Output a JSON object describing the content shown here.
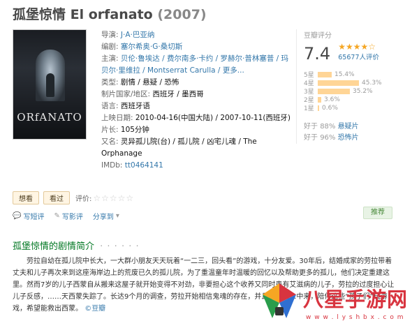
{
  "title": "孤堡惊情 El orfanato",
  "year": "(2007)",
  "poster_title": "ORfANATO",
  "info": {
    "director_label": "导演:",
    "director": "J·A·巴亚纳",
    "writer_label": "编剧:",
    "writer": "塞尔希奥·G·桑切斯",
    "cast_label": "主演:",
    "cast": "贝伦·鲁埃达 / 费尔南多·卡约 / 罗赫尔·普林塞普 / 玛贝尔·里维拉 / Montserrat Carulla /",
    "cast_more": "更多...",
    "genre_label": "类型:",
    "genre": "剧情 / 悬疑 / 恐怖",
    "country_label": "制片国家/地区:",
    "country": "西班牙 / 墨西哥",
    "language_label": "语言:",
    "language": "西班牙语",
    "release_label": "上映日期:",
    "release": "2010-04-16(中国大陆) / 2007-10-11(西班牙)",
    "runtime_label": "片长:",
    "runtime": "105分钟",
    "aka_label": "又名:",
    "aka": "灵异孤儿院(台) / 孤儿院 / 凶宅儿魂 / The Orphanage",
    "imdb_label": "IMDb:",
    "imdb": "tt0464141"
  },
  "rating": {
    "label": "豆瓣评分",
    "score": "7.4",
    "stars": "★★★★☆",
    "votes": "65677人评价",
    "breakdown": [
      {
        "label": "5星",
        "percent": "15.4%",
        "value": 15.4
      },
      {
        "label": "4星",
        "percent": "45.3%",
        "value": 45.3
      },
      {
        "label": "3星",
        "percent": "35.2%",
        "value": 35.2
      },
      {
        "label": "2星",
        "percent": "3.6%",
        "value": 3.6
      },
      {
        "label": "1星",
        "percent": "0.6%",
        "value": 0.6
      }
    ],
    "better1_prefix": "好于",
    "better1_pct": "88%",
    "better1_genre": "悬疑片",
    "better2_prefix": "好于",
    "better2_pct": "96%",
    "better2_genre": "恐怖片"
  },
  "actions": {
    "want": "想看",
    "watched": "看过",
    "rate_label": "评价:",
    "rate_stars": "☆☆☆☆☆",
    "short_review": "写短评",
    "review": "写影评",
    "share": "分享到",
    "share_arrow": "▾",
    "recommend": "推荐"
  },
  "section": {
    "title": "孤堡惊情的剧情简介",
    "dots": "· · · · · ·"
  },
  "synopsis": "劳拉自幼在孤儿院中长大，一大群小朋友天天玩着“一二三，回头看”的游戏，十分友爱。30年后，结婚成家的劳拉带着丈夫和儿子再次来到这座海岸边上的荒废已久的孤儿院，为了重温童年时温暖的回忆以及帮助更多的孤儿，他们决定重建这里。然而7岁的儿子西蒙自从搬来这屋子就开始变得不对劲，非要担心这个收养又同时患有艾滋病的儿子，劳拉的过度担心让儿子反感，……天西蒙失踪了。长达9个月的调查，劳拉开始相信鬼魂的存在，并且发现……中来，陪伴这些“孩子们”玩游戏，希望能救出西蒙。",
  "synopsis_more": "©豆瓣",
  "watermark": {
    "text": "八星手游网",
    "url": "w w w . l y s h b x . c o m",
    "colors": [
      "#d8343f",
      "#f6a623",
      "#2a9d4b",
      "#2f6fd1"
    ]
  }
}
